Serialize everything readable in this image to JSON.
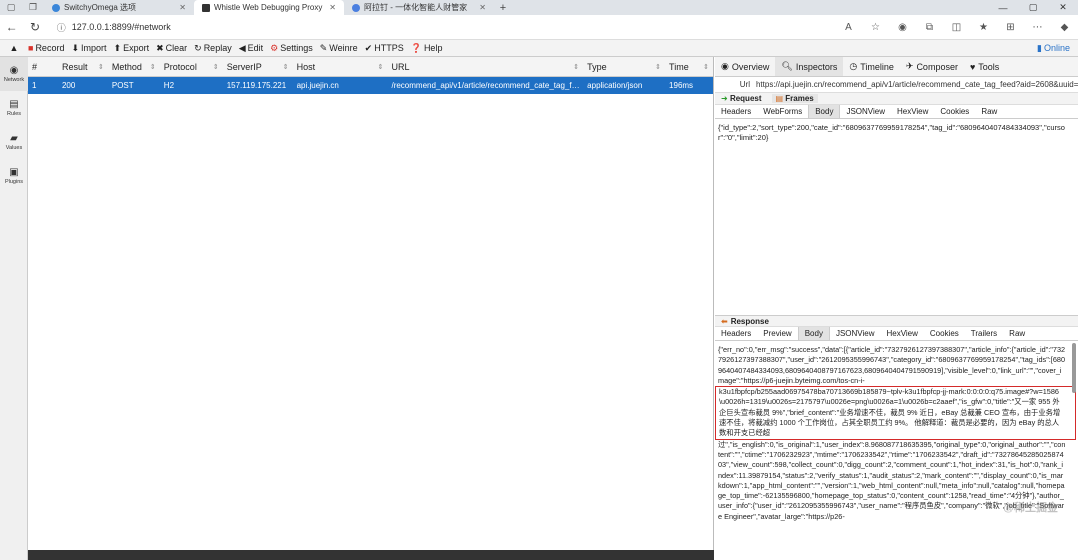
{
  "browser": {
    "tabs": [
      {
        "label": "SwitchyOmega 选项",
        "color": "#3a86d9"
      },
      {
        "label": "Whistle Web Debugging Proxy",
        "color": "#333333"
      },
      {
        "label": "阿拉钉 - 一体化智能人财管家",
        "color": "#4a7fe0"
      }
    ],
    "url": "127.0.0.1:8899/#network"
  },
  "toolbar": {
    "items": [
      "Record",
      "Import",
      "Export",
      "Clear",
      "Replay",
      "Edit",
      "Settings",
      "Weinre",
      "HTTPS",
      "Help"
    ],
    "online": "Online"
  },
  "sidenav": [
    "Network",
    "Rules",
    "Values",
    "Plugins"
  ],
  "network": {
    "columns": [
      "#",
      "Result",
      "Method",
      "Protocol",
      "ServerIP",
      "Host",
      "URL",
      "Type",
      "Time"
    ],
    "row": {
      "index": "1",
      "result": "200",
      "method": "POST",
      "protocol": "H2",
      "server_ip": "157.119.175.221",
      "host": "api.juejin.cn",
      "url": "/recommend_api/v1/article/recommend_cate_tag_feed...",
      "type": "application/json",
      "time": "196ms"
    }
  },
  "detail": {
    "tabs": [
      "Overview",
      "Inspectors",
      "Timeline",
      "Composer",
      "Tools"
    ],
    "url_label": "Url",
    "url_value": "https://api.juejin.cn/recommend_api/v1/article/recommend_cate_tag_feed?aid=2608&uuid=73",
    "request_label": "Request",
    "frames_label": "Frames",
    "request_tabs": [
      "Headers",
      "WebForms",
      "Body",
      "JSONView",
      "HexView",
      "Cookies",
      "Raw"
    ],
    "request_body": "{\"id_type\":2,\"sort_type\":200,\"cate_id\":\"6809637769959178254\",\"tag_id\":\"6809640407484334093\",\"cursor\":\"0\",\"limit\":20}",
    "response_label": "Response",
    "response_tabs": [
      "Headers",
      "Preview",
      "Body",
      "JSONView",
      "HexView",
      "Cookies",
      "Trailers",
      "Raw"
    ],
    "response_before": "{\"err_no\":0,\"err_msg\":\"success\",\"data\":[{\"article_id\":\"7327926127397388307\",\"article_info\":{\"article_id\":\"7327926127397388307\",\"user_id\":\"2612095355996743\",\"category_id\":\"6809637769959178254\",\"tag_ids\":[6809640407484334093,6809640408797167623,6809640404791590919],\"visible_level\":0,\"link_url\":\"\",\"cover_image\":\"https://p6-juejin.byteimg.com/tos-cn-i-",
    "response_highlight": "k3u1fbpfcp/b255aad06975478ba70713669b185879~tplv-k3u1fbpfcp-jj-mark:0:0:0:0:q75.image#?w=1586\\u0026h=1319\\u0026s=2175797\\u0026e=png\\u0026a=1\\u0026b=c2aaef\",\"is_gfw\":0,\"title\":\"又一家 955 外企巨头宣布裁员 9%\",\"brief_content\":\"业务增速不佳，裁员 9% 近日，eBay 总裁兼 CEO 宣布，由于业务增速不佳，将裁减约 1000 个工作岗位，占其全职员工约 9%。 他解释道：裁员是必要的，因为 eBay 的总人数和开支已经超",
    "response_after": "过\",\"is_english\":0,\"is_original\":1,\"user_index\":8.968087718635395,\"original_type\":0,\"original_author\":\"\",\"content\":\"\",\"ctime\":\"1706232923\",\"mtime\":\"1706233542\",\"rtime\":\"1706233542\",\"draft_id\":\"7327864528502587403\",\"view_count\":598,\"collect_count\":0,\"digg_count\":2,\"comment_count\":1,\"hot_index\":31,\"is_hot\":0,\"rank_index\":11.39879154,\"status\":2,\"verify_status\":1,\"audit_status\":2,\"mark_content\":\"\",\"display_count\":0,\"is_markdown\":1,\"app_html_content\":\"\",\"version\":1,\"web_html_content\":null,\"meta_info\":null,\"catalog\":null,\"homepage_top_time\":-62135596800,\"homepage_top_status\":0,\"content_count\":1258,\"read_time\":\"4分钟\"},\"author_user_info\":{\"user_id\":\"2612095355996743\",\"user_name\":\"程序员鱼皮\",\"company\":\"微软\",\"job_title\":\"Software Engineer\",\"avatar_large\":\"https://p26-",
    "watermark": "@稀土掘金"
  }
}
